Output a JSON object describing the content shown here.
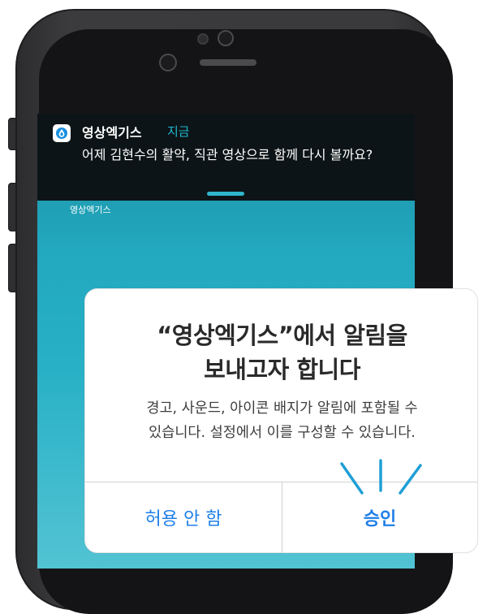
{
  "notification": {
    "app_name": "영상엑기스",
    "time": "지금",
    "message": "어제 김현수의 활약, 직관 영상으로 함께 다시 볼까요?"
  },
  "home_screen": {
    "app_label": "영상엑기스"
  },
  "alert": {
    "title_line1": "“영상엑기스”에서 알림을",
    "title_line2": "보내고자 합니다",
    "message_line1": "경고, 사운드, 아이콘 배지가 알림에 포함될 수",
    "message_line2": "있습니다. 설정에서 이를 구성할 수 있습니다.",
    "deny_label": "허용 안 함",
    "allow_label": "승인"
  },
  "icons": {
    "app_icon": "water-drop-icon",
    "emphasis": "emphasis-lines-icon"
  },
  "colors": {
    "accent_blue": "#1f7fe8",
    "notification_time": "#22b8d0",
    "screen_teal": "#22a8bf",
    "emphasis_lines": "#1f9fd6"
  }
}
